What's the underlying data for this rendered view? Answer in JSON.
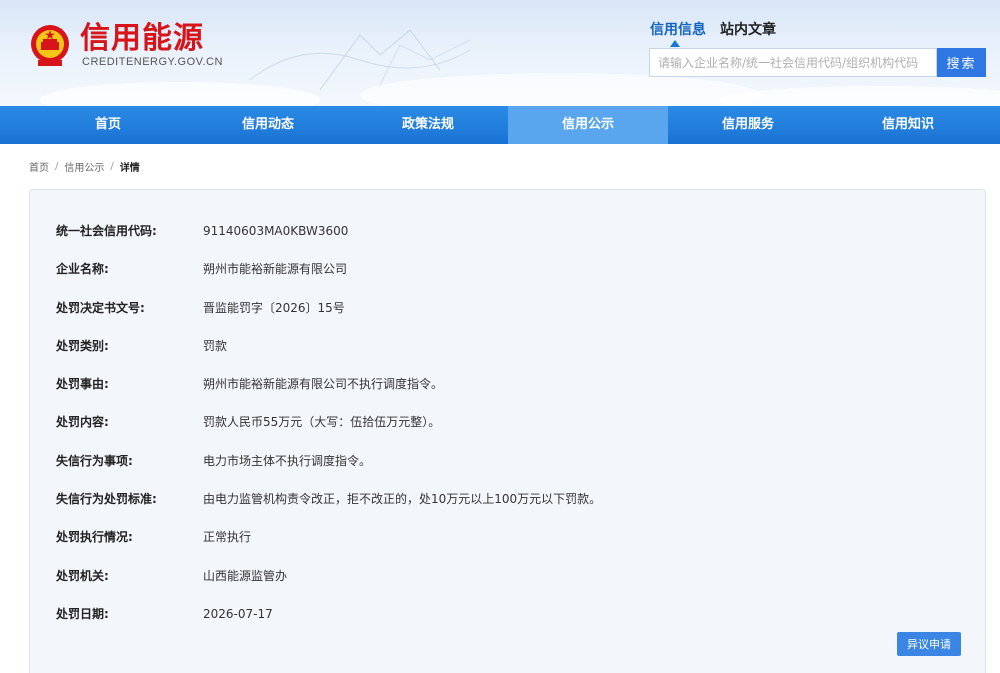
{
  "header": {
    "site_title": "信用能源",
    "site_domain": "CREDITENERGY.GOV.CN",
    "search_tabs": [
      {
        "label": "信用信息",
        "active": true
      },
      {
        "label": "站内文章",
        "active": false
      }
    ],
    "search_placeholder": "请输入企业名称/统一社会信用代码/组织机构代码",
    "search_button": "搜索"
  },
  "nav": {
    "items": [
      {
        "label": "首页",
        "active": false
      },
      {
        "label": "信用动态",
        "active": false
      },
      {
        "label": "政策法规",
        "active": false
      },
      {
        "label": "信用公示",
        "active": true
      },
      {
        "label": "信用服务",
        "active": false
      },
      {
        "label": "信用知识",
        "active": false
      }
    ]
  },
  "breadcrumb": {
    "items": [
      "首页",
      "信用公示"
    ],
    "current": "详情",
    "separator": "/"
  },
  "detail": {
    "rows": [
      {
        "label": "统一社会信用代码:",
        "value": "91140603MA0KBW3600"
      },
      {
        "label": "企业名称:",
        "value": "朔州市能裕新能源有限公司"
      },
      {
        "label": "处罚决定书文号:",
        "value": "晋监能罚字〔2026〕15号"
      },
      {
        "label": "处罚类别:",
        "value": "罚款"
      },
      {
        "label": "处罚事由:",
        "value": "朔州市能裕新能源有限公司不执行调度指令。"
      },
      {
        "label": "处罚内容:",
        "value": "罚款人民币55万元（大写：伍拾伍万元整）。"
      },
      {
        "label": "失信行为事项:",
        "value": "电力市场主体不执行调度指令。"
      },
      {
        "label": "失信行为处罚标准:",
        "value": "由电力监管机构责令改正，拒不改正的，处10万元以上100万元以下罚款。"
      },
      {
        "label": "处罚执行情况:",
        "value": "正常执行"
      },
      {
        "label": "处罚机关:",
        "value": "山西能源监管办"
      },
      {
        "label": "处罚日期:",
        "value": "2026-07-17"
      }
    ],
    "objection_button": "异议申请"
  },
  "colors": {
    "brand_red": "#d7141a",
    "nav_blue": "#1a72d3",
    "nav_active": "#5aa6ee",
    "button_blue": "#2f78e4"
  }
}
